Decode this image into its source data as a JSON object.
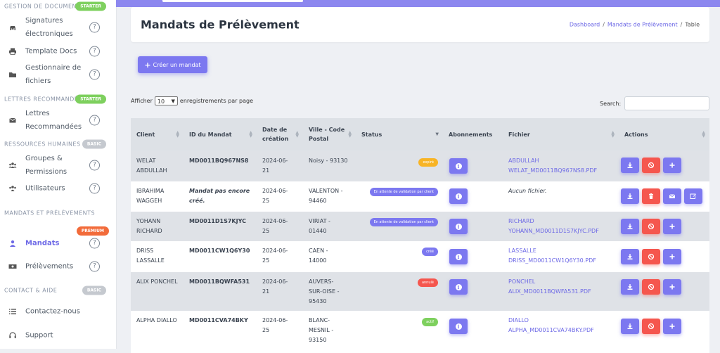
{
  "colors": {
    "accent": "#7c78f0",
    "danger": "#f5564e",
    "starter": "#7ed05e",
    "basic": "#c5c9cf",
    "premium": "#f26b3a",
    "expired": "#f8b425",
    "pending": "#7c78f0",
    "created": "#7c78f0",
    "cancelled": "#f5564e",
    "active": "#7ed05e"
  },
  "sidebar": {
    "sections": [
      {
        "label": "GESTION DE DOCUMENTS",
        "badge": "STARTER",
        "badge_color": "#7ed05e"
      },
      {
        "label": "LETTRES RECOMMANDÉES",
        "badge": "STARTER",
        "badge_color": "#7ed05e"
      },
      {
        "label": "RESSOURCES HUMAINES",
        "badge": "BASIC",
        "badge_color": "#c5c9cf"
      },
      {
        "label": "MANDATS ET PRÉLÈVEMENTS",
        "badge": "PREMIUM",
        "badge_color": "#f26b3a"
      },
      {
        "label": "CONTACT & AIDE",
        "badge": "BASIC",
        "badge_color": "#c5c9cf"
      }
    ],
    "items": [
      {
        "label": "Signatures électroniques",
        "icon": "car-icon",
        "help": "?"
      },
      {
        "label": "Template Docs",
        "icon": "printer-icon",
        "help": "?"
      },
      {
        "label": "Gestionnaire de fichiers",
        "icon": "folder-icon",
        "help": "?"
      },
      {
        "label": "Lettres Recommandées",
        "icon": "envelope-icon",
        "help": "?"
      },
      {
        "label": "Groupes & Permissions",
        "icon": "users-icon",
        "help": "?"
      },
      {
        "label": "Utilisateurs",
        "icon": "users-icon",
        "help": "?"
      },
      {
        "label": "Mandats",
        "icon": "user-badge-icon",
        "help": "?"
      },
      {
        "label": "Prélèvements",
        "icon": "money-icon",
        "help": "?"
      },
      {
        "label": "Contactez-nous",
        "icon": "list-icon",
        "help": ""
      },
      {
        "label": "Support",
        "icon": "headset-icon",
        "help": ""
      }
    ]
  },
  "header": {
    "title": "Mandats de Prélèvement",
    "breadcrumb": [
      "Dashboard",
      "Mandats de Prélèvement",
      "Table"
    ]
  },
  "create_button": "Créer un mandat",
  "table_controls": {
    "show_prefix": "Afficher",
    "page_size": "10",
    "show_suffix": "enregistrements par page",
    "search_label": "Search:"
  },
  "table": {
    "columns": [
      "Client",
      "ID du Mandat",
      "Date de création",
      "Ville - Code Postal",
      "Status",
      "Abonnements",
      "Fichier",
      "Actions"
    ],
    "rows": [
      {
        "client": "WELAT ABDULLAH",
        "id": "MD0011BQ967NS8",
        "id_italic": false,
        "date": "2024-06-21",
        "ville": "Noisy - 93130",
        "status": "expiré",
        "status_color": "#f8b425",
        "file": "ABDULLAH WELAT_MD0011BQ967NS8.PDF",
        "file_link": true
      },
      {
        "client": "IBRAHIMA WAGGEH",
        "id": "Mandat pas encore créé.",
        "id_italic": true,
        "date": "2024-06-25",
        "ville": "VALENTON - 94460",
        "status": "En attente de validation par client",
        "status_color": "#7c78f0",
        "file": "Aucun fichier.",
        "file_link": false
      },
      {
        "client": "YOHANN RICHARD",
        "id": "MD0011D1S7KJYC",
        "id_italic": false,
        "date": "2024-06-25",
        "ville": "VIRIAT - 01440",
        "status": "En attente de validation par client",
        "status_color": "#7c78f0",
        "file": "RICHARD YOHANN_MD0011D1S7KJYC.PDF",
        "file_link": true
      },
      {
        "client": "DRISS LASSALLE",
        "id": "MD0011CW1Q6Y30",
        "id_italic": false,
        "date": "2024-06-25",
        "ville": "CAEN - 14000",
        "status": "créé",
        "status_color": "#7c78f0",
        "file": "LASSALLE DRISS_MD0011CW1Q6Y30.PDF",
        "file_link": true
      },
      {
        "client": "ALIX PONCHEL",
        "id": "MD0011BQWFA531",
        "id_italic": false,
        "date": "2024-06-21",
        "ville": "AUVERS-SUR-OISE - 95430",
        "status": "annulé",
        "status_color": "#f5564e",
        "file": "PONCHEL ALIX_MD0011BQWFA531.PDF",
        "file_link": true
      },
      {
        "client": "ALPHA DIALLO",
        "id": "MD0011CVA74BKY",
        "id_italic": false,
        "date": "2024-06-25",
        "ville": "BLANC-MESNIL - 93150",
        "status": "actif",
        "status_color": "#7ed05e",
        "file": "DIALLO ALPHA_MD0011CVA74BKY.PDF",
        "file_link": true
      }
    ]
  }
}
